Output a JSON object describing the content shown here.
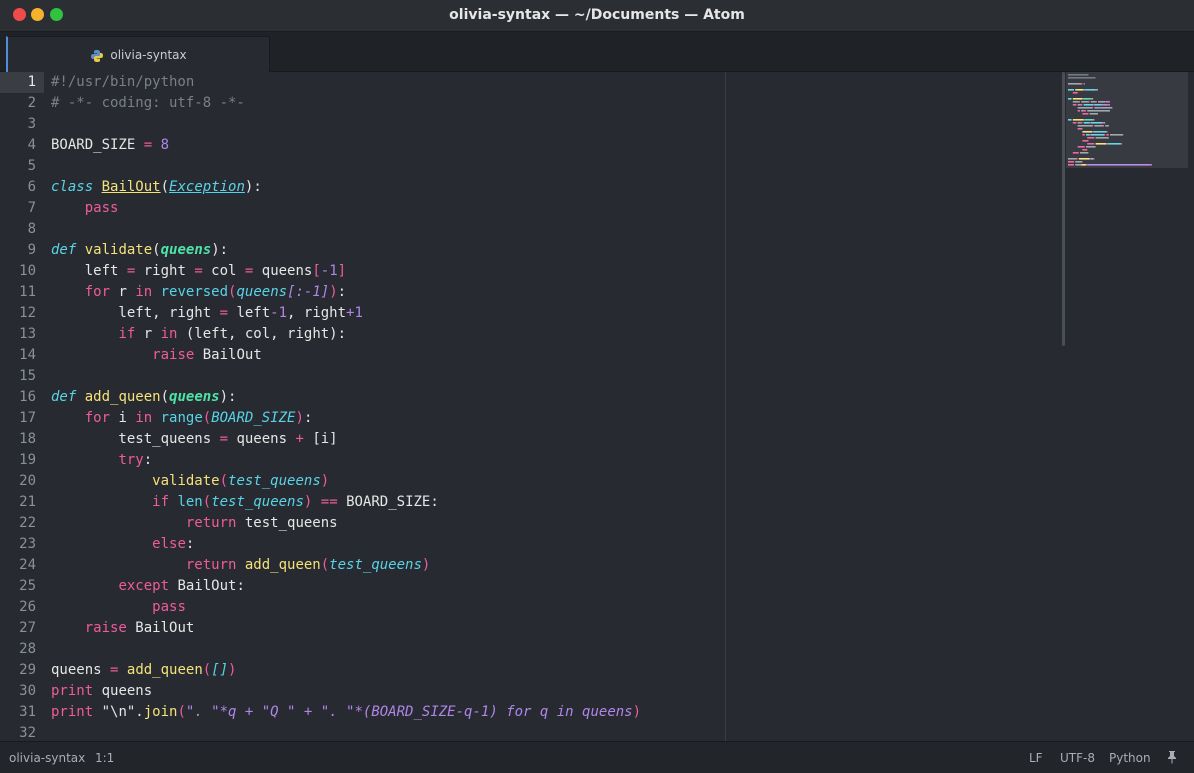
{
  "window": {
    "title": "olivia-syntax — ~/Documents — Atom"
  },
  "tabs": [
    {
      "label": "olivia-syntax",
      "icon": "python-icon"
    }
  ],
  "editor": {
    "current_line": 1,
    "lines": [
      [
        {
          "t": "#!/usr/bin/python",
          "c": "comment"
        }
      ],
      [
        {
          "t": "# -*- coding: utf-8 -*-",
          "c": "comment"
        }
      ],
      [],
      [
        {
          "t": "BOARD_SIZE ",
          "c": ""
        },
        {
          "t": "=",
          "c": "op"
        },
        {
          "t": " ",
          "c": ""
        },
        {
          "t": "8",
          "c": "number"
        }
      ],
      [],
      [
        {
          "t": "class",
          "c": "storage"
        },
        {
          "t": " ",
          "c": ""
        },
        {
          "t": "BailOut",
          "c": "classname"
        },
        {
          "t": "(",
          "c": ""
        },
        {
          "t": "Exception",
          "c": "inherit"
        },
        {
          "t": "):",
          "c": ""
        }
      ],
      [
        {
          "t": "    ",
          "c": ""
        },
        {
          "t": "pass",
          "c": "keyword"
        }
      ],
      [],
      [
        {
          "t": "def",
          "c": "storage"
        },
        {
          "t": " ",
          "c": ""
        },
        {
          "t": "validate",
          "c": "func"
        },
        {
          "t": "(",
          "c": ""
        },
        {
          "t": "queens",
          "c": "param"
        },
        {
          "t": "):",
          "c": ""
        }
      ],
      [
        {
          "t": "    left ",
          "c": ""
        },
        {
          "t": "=",
          "c": "op"
        },
        {
          "t": " right ",
          "c": ""
        },
        {
          "t": "=",
          "c": "op"
        },
        {
          "t": " col ",
          "c": ""
        },
        {
          "t": "=",
          "c": "op"
        },
        {
          "t": " queens",
          "c": ""
        },
        {
          "t": "[",
          "c": "bracket"
        },
        {
          "t": "-1",
          "c": "number"
        },
        {
          "t": "]",
          "c": "bracket"
        }
      ],
      [
        {
          "t": "    ",
          "c": ""
        },
        {
          "t": "for",
          "c": "keyword"
        },
        {
          "t": " r ",
          "c": ""
        },
        {
          "t": "in",
          "c": "keyword"
        },
        {
          "t": " ",
          "c": ""
        },
        {
          "t": "reversed",
          "c": "builtin"
        },
        {
          "t": "(",
          "c": "bracket"
        },
        {
          "t": "queens",
          "c": "arg"
        },
        {
          "t": "[:-1]",
          "c": "strarg"
        },
        {
          "t": ")",
          "c": "bracket"
        },
        {
          "t": ":",
          "c": ""
        }
      ],
      [
        {
          "t": "        left, right ",
          "c": ""
        },
        {
          "t": "=",
          "c": "op"
        },
        {
          "t": " left",
          "c": ""
        },
        {
          "t": "-1",
          "c": "number"
        },
        {
          "t": ", right",
          "c": ""
        },
        {
          "t": "+1",
          "c": "number"
        }
      ],
      [
        {
          "t": "        ",
          "c": ""
        },
        {
          "t": "if",
          "c": "keyword"
        },
        {
          "t": " r ",
          "c": ""
        },
        {
          "t": "in",
          "c": "keyword"
        },
        {
          "t": " (left, col, right):",
          "c": ""
        }
      ],
      [
        {
          "t": "            ",
          "c": ""
        },
        {
          "t": "raise",
          "c": "keyword"
        },
        {
          "t": " BailOut",
          "c": ""
        }
      ],
      [],
      [
        {
          "t": "def",
          "c": "storage"
        },
        {
          "t": " ",
          "c": ""
        },
        {
          "t": "add_queen",
          "c": "func"
        },
        {
          "t": "(",
          "c": ""
        },
        {
          "t": "queens",
          "c": "param"
        },
        {
          "t": "):",
          "c": ""
        }
      ],
      [
        {
          "t": "    ",
          "c": ""
        },
        {
          "t": "for",
          "c": "keyword"
        },
        {
          "t": " i ",
          "c": ""
        },
        {
          "t": "in",
          "c": "keyword"
        },
        {
          "t": " ",
          "c": ""
        },
        {
          "t": "range",
          "c": "builtin"
        },
        {
          "t": "(",
          "c": "bracket"
        },
        {
          "t": "BOARD_SIZE",
          "c": "arg"
        },
        {
          "t": ")",
          "c": "bracket"
        },
        {
          "t": ":",
          "c": ""
        }
      ],
      [
        {
          "t": "        test_queens ",
          "c": ""
        },
        {
          "t": "=",
          "c": "op"
        },
        {
          "t": " queens ",
          "c": ""
        },
        {
          "t": "+",
          "c": "op"
        },
        {
          "t": " [i]",
          "c": ""
        }
      ],
      [
        {
          "t": "        ",
          "c": ""
        },
        {
          "t": "try",
          "c": "keyword"
        },
        {
          "t": ":",
          "c": ""
        }
      ],
      [
        {
          "t": "            ",
          "c": ""
        },
        {
          "t": "validate",
          "c": "func"
        },
        {
          "t": "(",
          "c": "bracket"
        },
        {
          "t": "test_queens",
          "c": "arg"
        },
        {
          "t": ")",
          "c": "bracket"
        }
      ],
      [
        {
          "t": "            ",
          "c": ""
        },
        {
          "t": "if",
          "c": "keyword"
        },
        {
          "t": " ",
          "c": ""
        },
        {
          "t": "len",
          "c": "builtin"
        },
        {
          "t": "(",
          "c": "bracket"
        },
        {
          "t": "test_queens",
          "c": "arg"
        },
        {
          "t": ")",
          "c": "bracket"
        },
        {
          "t": " ",
          "c": ""
        },
        {
          "t": "==",
          "c": "op"
        },
        {
          "t": " BOARD_SIZE:",
          "c": ""
        }
      ],
      [
        {
          "t": "                ",
          "c": ""
        },
        {
          "t": "return",
          "c": "keyword"
        },
        {
          "t": " test_queens",
          "c": ""
        }
      ],
      [
        {
          "t": "            ",
          "c": ""
        },
        {
          "t": "else",
          "c": "keyword"
        },
        {
          "t": ":",
          "c": ""
        }
      ],
      [
        {
          "t": "                ",
          "c": ""
        },
        {
          "t": "return",
          "c": "keyword"
        },
        {
          "t": " ",
          "c": ""
        },
        {
          "t": "add_queen",
          "c": "func"
        },
        {
          "t": "(",
          "c": "bracket"
        },
        {
          "t": "test_queens",
          "c": "arg"
        },
        {
          "t": ")",
          "c": "bracket"
        }
      ],
      [
        {
          "t": "        ",
          "c": ""
        },
        {
          "t": "except",
          "c": "keyword"
        },
        {
          "t": " BailOut:",
          "c": ""
        }
      ],
      [
        {
          "t": "            ",
          "c": ""
        },
        {
          "t": "pass",
          "c": "keyword"
        }
      ],
      [
        {
          "t": "    ",
          "c": ""
        },
        {
          "t": "raise",
          "c": "keyword"
        },
        {
          "t": " BailOut",
          "c": ""
        }
      ],
      [],
      [
        {
          "t": "queens ",
          "c": ""
        },
        {
          "t": "=",
          "c": "op"
        },
        {
          "t": " ",
          "c": ""
        },
        {
          "t": "add_queen",
          "c": "func"
        },
        {
          "t": "(",
          "c": "bracket"
        },
        {
          "t": "[]",
          "c": "arg"
        },
        {
          "t": ")",
          "c": "bracket"
        }
      ],
      [
        {
          "t": "print",
          "c": "keyword"
        },
        {
          "t": " queens",
          "c": ""
        }
      ],
      [
        {
          "t": "print",
          "c": "keyword"
        },
        {
          "t": " \"\\n\".",
          "c": ""
        },
        {
          "t": "join",
          "c": "func"
        },
        {
          "t": "(",
          "c": "bracket"
        },
        {
          "t": "\". \"*q + \"Q \" + \". \"*(BOARD_SIZE-q-1) for q in queens",
          "c": "strarg"
        },
        {
          "t": ")",
          "c": "bracket"
        }
      ],
      []
    ]
  },
  "status_bar": {
    "file": "olivia-syntax",
    "cursor": "1:1",
    "line_ending": "LF",
    "encoding": "UTF-8",
    "grammar": "Python",
    "pin_icon": "pushpin-icon"
  },
  "colors": {
    "comment": "#7a7f88",
    "keyword": "#ee5c9c",
    "storage": "#5ad3e6",
    "function": "#f4e27a",
    "parameter": "#4ee3a8",
    "number": "#b086e8",
    "background": "#272a30"
  }
}
